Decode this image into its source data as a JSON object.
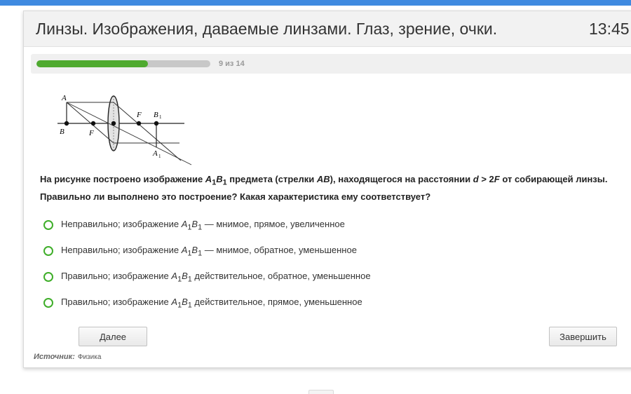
{
  "header": {
    "title": "Линзы. Изображения, даваемые линзами. Глаз, зрение, очки.",
    "timer": "13:45"
  },
  "progress": {
    "text": "9 из 14",
    "current": 9,
    "total": 14,
    "fill_color": "#4faa2f"
  },
  "figure": {
    "label_A": "A",
    "label_B": "B",
    "label_F_left": "F",
    "label_F_right": "F",
    "label_B1": "B",
    "label_B1_sub": "1",
    "label_A1": "A",
    "label_A1_sub": "1"
  },
  "question": {
    "part1": "На рисунке построено изображение ",
    "img_A": "A",
    "img_sub1": "1",
    "img_B": "B",
    "img_sub2": "1",
    "part2": " предмета (стрелки ",
    "object": "AB",
    "part3": "), находящегося на расстоянии ",
    "d": "d",
    "part4": " > 2",
    "F": "F",
    "part5": " от собирающей линзы. Правильно ли выполнено это построение? Какая характеристика ему соответствует?"
  },
  "options": [
    {
      "prefix": "Неправильно; изображение ",
      "a": "A",
      "s1": "1",
      "b": "B",
      "s2": "1",
      "suffix": " — мнимое, прямое, увеличенное"
    },
    {
      "prefix": "Неправильно; изображение ",
      "a": "A",
      "s1": "1",
      "b": "B",
      "s2": "1",
      "suffix": " — мнимое, обратное, уменьшенное"
    },
    {
      "prefix": "Правильно; изображение ",
      "a": "A",
      "s1": "1",
      "b": "B",
      "s2": "1",
      "suffix": " действительное, обратное, уменьшенное"
    },
    {
      "prefix": "Правильно; изображение ",
      "a": "A",
      "s1": "1",
      "b": "B",
      "s2": "1",
      "suffix": " действительное, прямое, уменьшенное"
    }
  ],
  "buttons": {
    "next": "Далее",
    "finish": "Завершить"
  },
  "source": {
    "label": "Источник:",
    "value": "Физика"
  },
  "colors": {
    "accent_bar": "#3f8ae0",
    "radio_border": "#3fae2a"
  }
}
